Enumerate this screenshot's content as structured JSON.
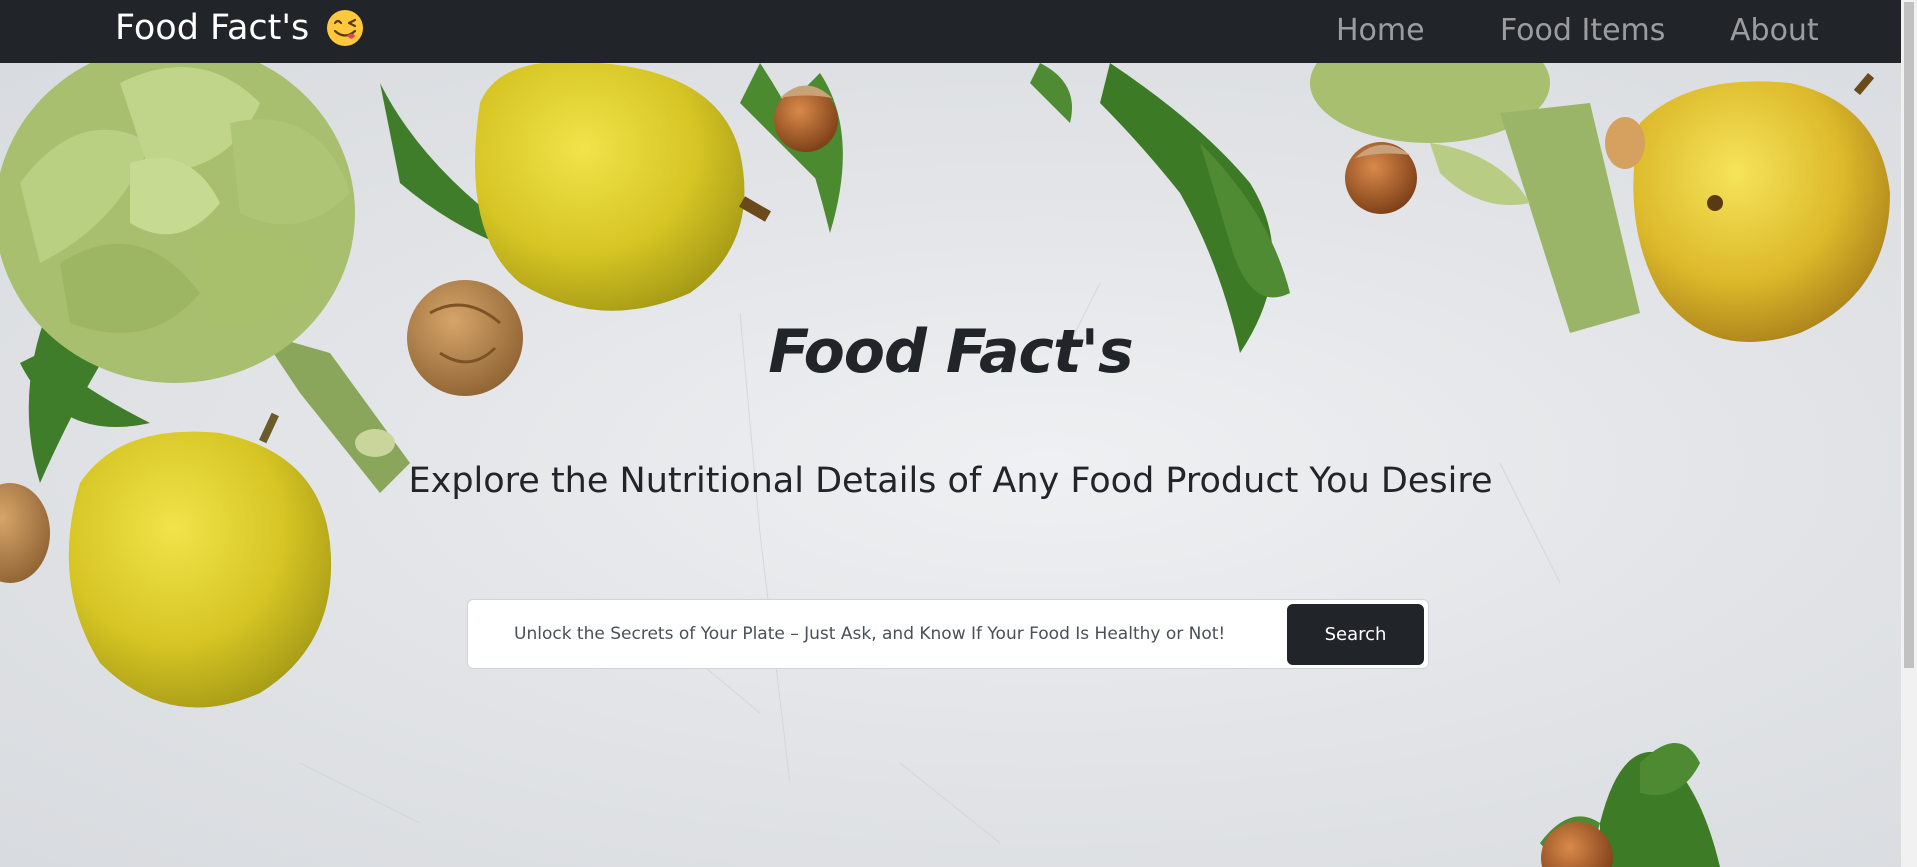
{
  "navbar": {
    "brand": "Food Fact's",
    "brand_emoji_icon": "face-savoring-food-icon",
    "links": [
      {
        "label": "Home"
      },
      {
        "label": "Food Items"
      },
      {
        "label": "About"
      }
    ],
    "background_color": "#212529"
  },
  "hero": {
    "title": "Food Fact's",
    "subtitle": "Explore the Nutritional Details of Any Food Product You Desire",
    "background_image": "vegetables-on-marble-photo"
  },
  "search": {
    "placeholder": "Unlock the Secrets of Your Plate – Just Ask, and Know If Your Food Is Healthy or Not!",
    "button_label": "Search"
  },
  "colors": {
    "dark": "#212529",
    "pear": "#d9c829",
    "artichoke": "#a7bf6e",
    "herb": "#3f7d2a",
    "nut": "#a36a35"
  }
}
